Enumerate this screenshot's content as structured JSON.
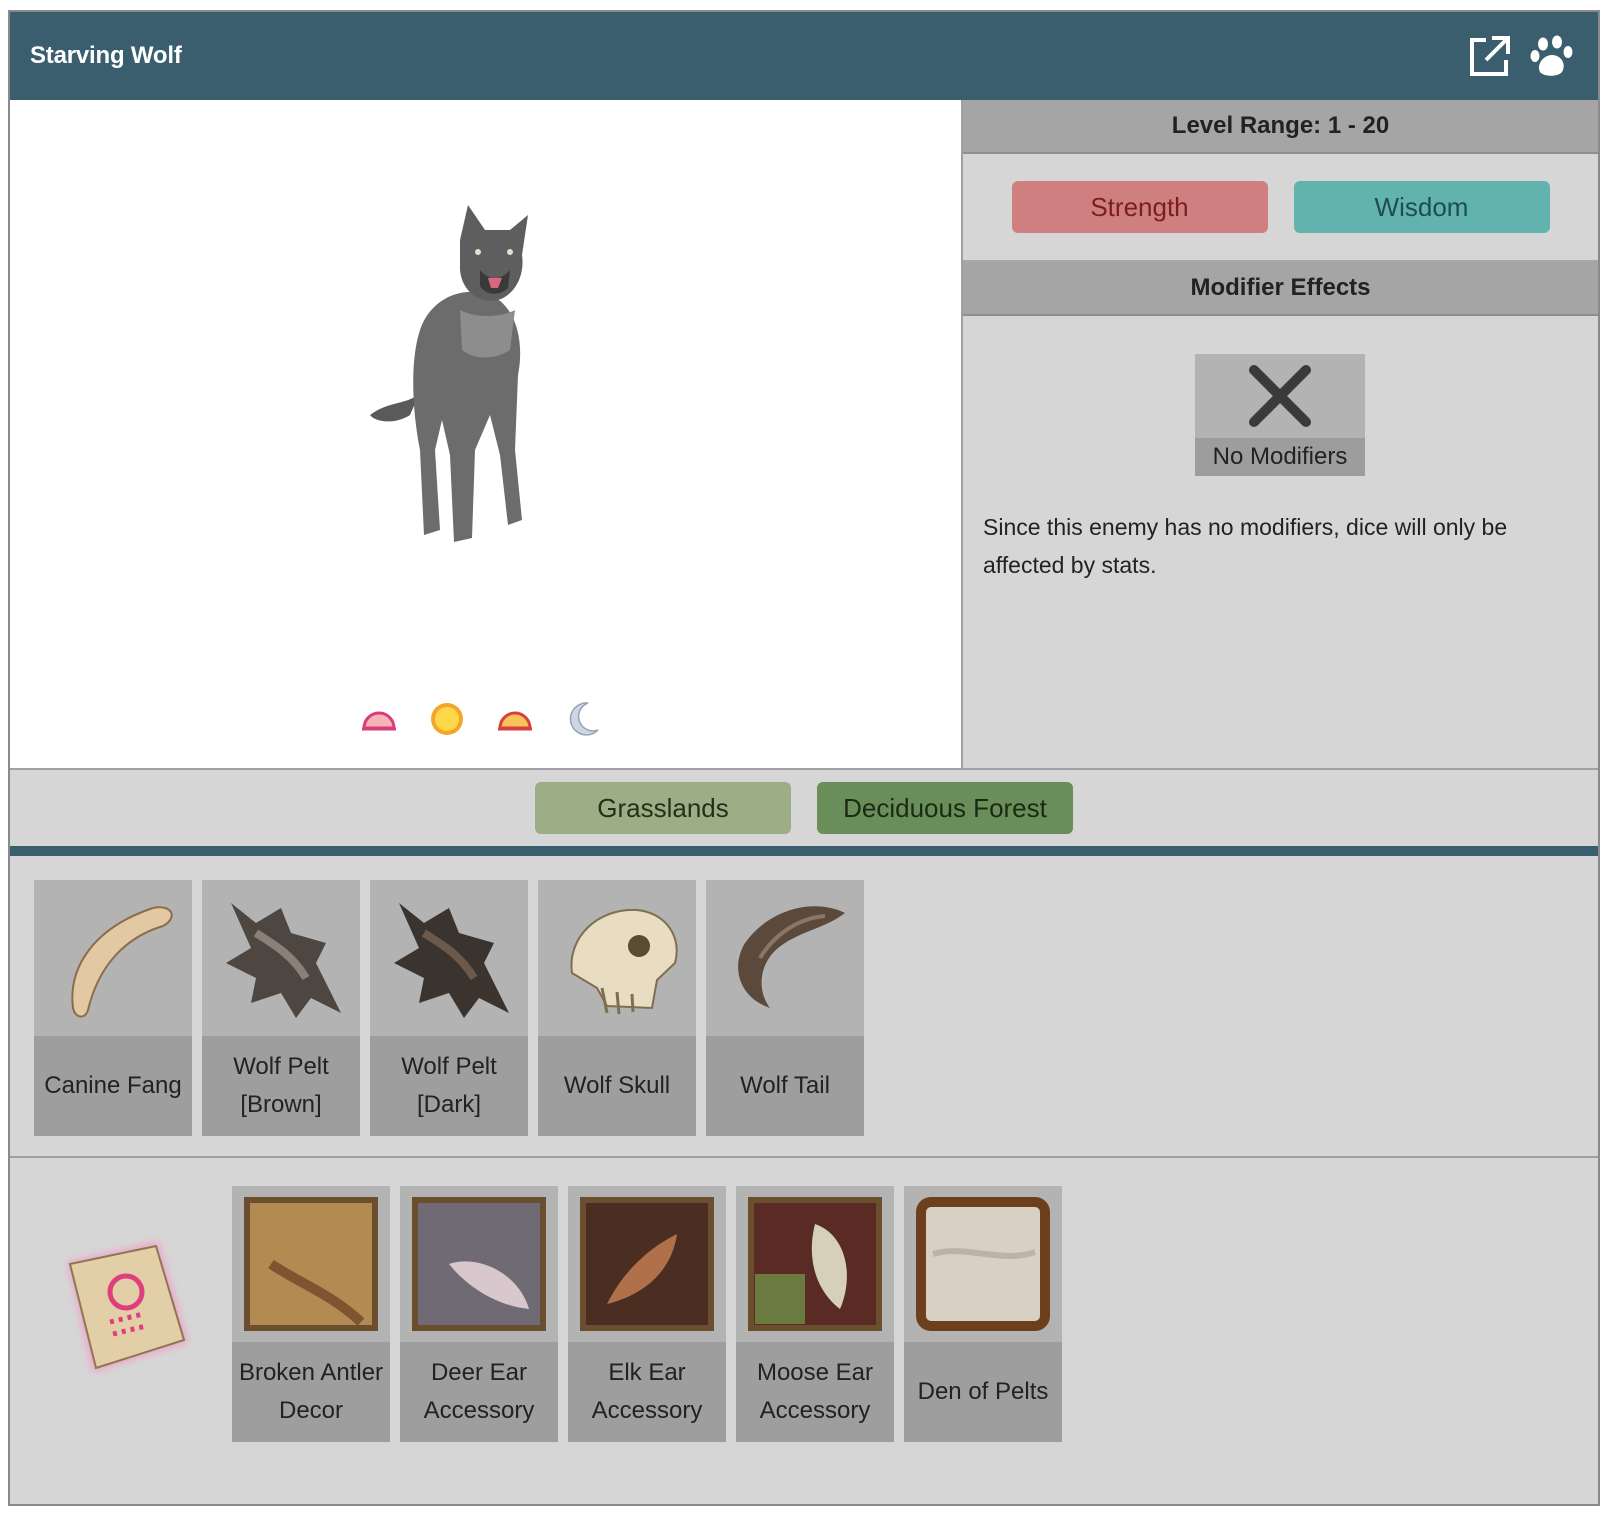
{
  "header": {
    "title": "Starving Wolf",
    "icons": [
      "external-link-icon",
      "paw-icon"
    ]
  },
  "creature": {
    "image": "wolf-illustration",
    "time_of_day": [
      "dawn-icon",
      "sun-icon",
      "dusk-icon",
      "moon-icon"
    ]
  },
  "info": {
    "level_range": "Level Range: 1 - 20",
    "stats": [
      {
        "label": "Strength",
        "color": "#cf7f7f"
      },
      {
        "label": "Wisdom",
        "color": "#62b3ad"
      }
    ],
    "modifier_heading": "Modifier Effects",
    "no_modifiers_label": "No Modifiers",
    "note": "Since this enemy has no modifiers, dice will only be affected by stats."
  },
  "habitats": [
    {
      "label": "Grasslands",
      "color": "#9cae86"
    },
    {
      "label": "Deciduous Forest",
      "color": "#6a8e59"
    }
  ],
  "drops": [
    {
      "label": "Canine Fang",
      "icon": "fang-icon"
    },
    {
      "label": "Wolf Pelt [Brown]",
      "icon": "pelt-brown-icon"
    },
    {
      "label": "Wolf Pelt [Dark]",
      "icon": "pelt-dark-icon"
    },
    {
      "label": "Wolf Skull",
      "icon": "skull-icon"
    },
    {
      "label": "Wolf Tail",
      "icon": "tail-icon"
    }
  ],
  "rewards": {
    "scroll_icon": "magic-scroll-icon",
    "items": [
      {
        "label": "Broken Antler Decor",
        "icon": "antler-decor-icon"
      },
      {
        "label": "Deer Ear Accessory",
        "icon": "deer-ear-icon"
      },
      {
        "label": "Elk Ear Accessory",
        "icon": "elk-ear-icon"
      },
      {
        "label": "Moose Ear Accessory",
        "icon": "moose-ear-icon"
      },
      {
        "label": "Den of Pelts",
        "icon": "den-of-pelts-icon"
      }
    ]
  },
  "colors": {
    "header": "#3b5e6f",
    "panel": "#d6d6d6",
    "band": "#a5a5a5"
  }
}
